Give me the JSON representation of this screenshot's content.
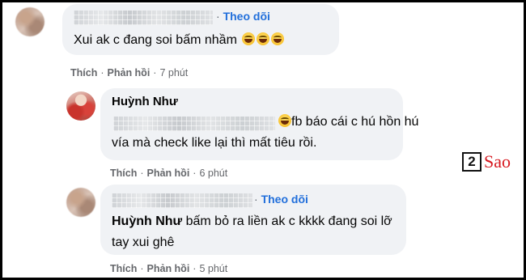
{
  "comments": [
    {
      "follow_label": "Theo dõi",
      "dot": "·",
      "text": "Xui ak c đang soi bấm nhầm",
      "emoji": "laughing-emoji",
      "actions": {
        "like": "Thích",
        "reply": "Phản hồi",
        "time": "7 phút"
      }
    },
    {
      "author": "Huỳnh Như",
      "text_line1": "fb báo cái c hú hồn hú",
      "text_line2": "vía mà check like lại thì mất tiêu rồi.",
      "emoji": "rofl-emoji",
      "actions": {
        "like": "Thích",
        "reply": "Phản hồi",
        "time": "6 phút"
      }
    },
    {
      "follow_label": "Theo dõi",
      "dot": "·",
      "mention": "Huỳnh Như",
      "text_line1": "bấm bỏ ra liền ak c kkkk đang soi lỡ",
      "text_line2": "tay xui ghê",
      "actions": {
        "like": "Thích",
        "reply": "Phản hồi",
        "time": "5 phút"
      }
    }
  ],
  "separator": "·",
  "watermark": {
    "number": "2",
    "word": "Sao"
  }
}
